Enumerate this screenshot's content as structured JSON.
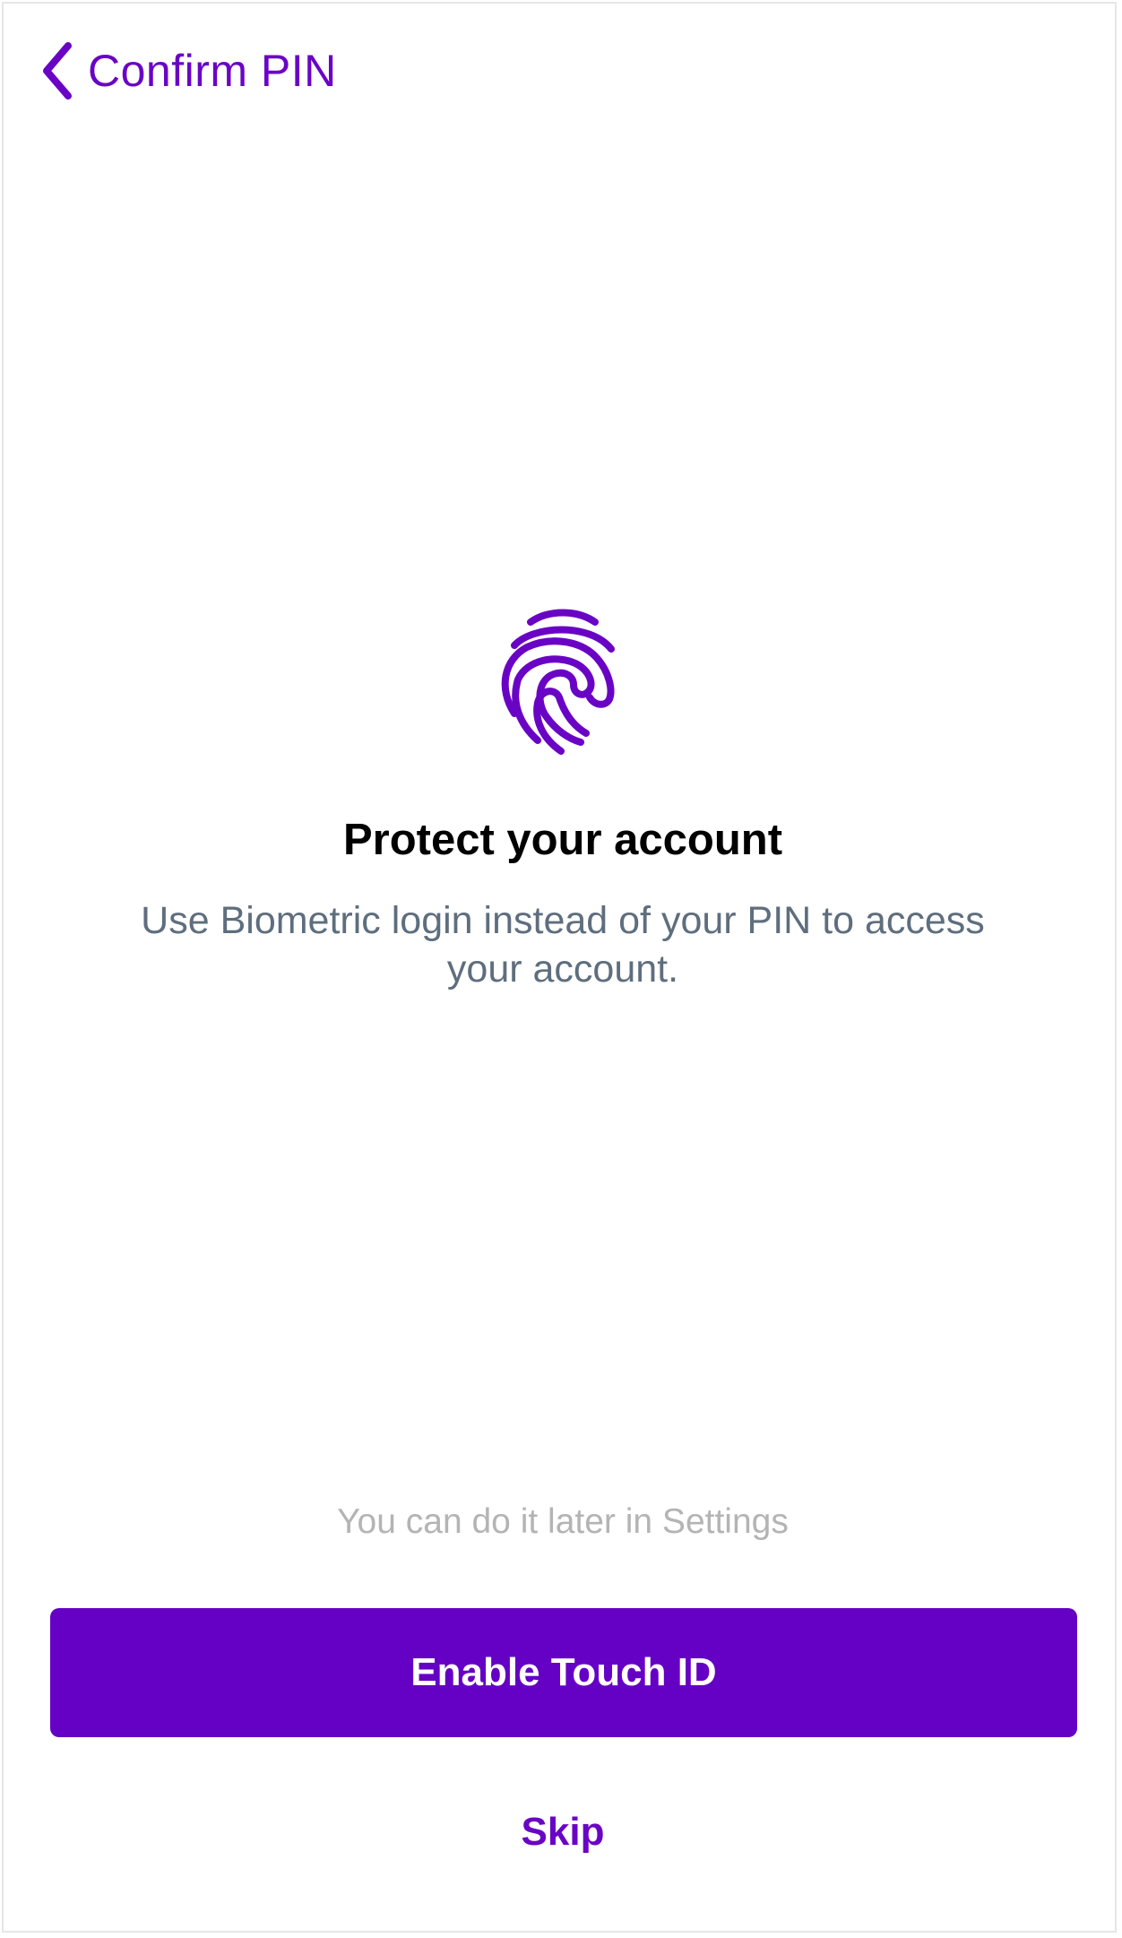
{
  "nav": {
    "back_label": "Confirm PIN",
    "back_icon": "chevron-left-icon"
  },
  "content": {
    "icon": "fingerprint-icon",
    "title": "Protect your account",
    "subtitle": "Use Biometric login instead of your PIN to access your account."
  },
  "footer": {
    "hint": "You can do it later in Settings",
    "primary_label": "Enable Touch ID",
    "skip_label": "Skip"
  },
  "colors": {
    "accent": "#6500c5",
    "link": "#6a04c5",
    "title": "#000000",
    "subtitle": "#5e6e7e",
    "hint": "#b4b4b4",
    "background": "#ffffff"
  }
}
